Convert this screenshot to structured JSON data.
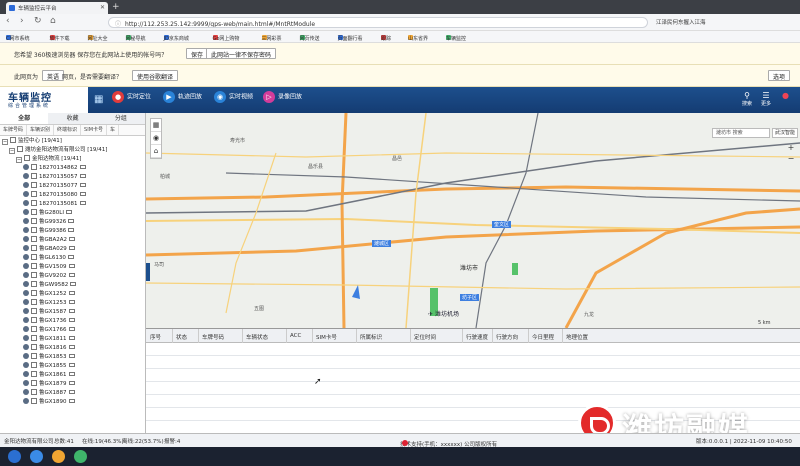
{
  "browser": {
    "tab_title": "车辆监控云平台",
    "url": "http://112.253.25.142:9999/gps-web/main.html#/MntRtModule",
    "address_right": "江泽民何东握入江海",
    "bookmarks": [
      "C网市系统",
      "软件下载",
      "网址大全",
      "网秘导航",
      "JD京东商城",
      "Go网上购物",
      "三网彩票",
      "网页传送",
      "页面翻行看",
      "跟踪",
      "山东省界",
      "车辆监控"
    ]
  },
  "notices": {
    "save_password_text": "您希望 360极速浏览器 保存您在此网站上使用的帐号吗？",
    "save_button": "保存",
    "never_button": "此网站一律不保存密码",
    "translate_prefix": "此网页为",
    "translate_lang_button": "英语",
    "translate_text": "网页，是否需要翻译？",
    "translate_button": "使用谷歌翻译",
    "options_button": "选项"
  },
  "app": {
    "title": "车辆监控",
    "subtitle": "综合管理系统",
    "nav": [
      {
        "label": "实时定位",
        "color": "#e23c3c"
      },
      {
        "label": "轨迹回放",
        "color": "#2a83d8"
      },
      {
        "label": "实时视频",
        "color": "#2a83d8"
      },
      {
        "label": "录像回放",
        "color": "#d23c9a"
      }
    ],
    "header_right": [
      "搜索",
      "更多"
    ]
  },
  "sidebar": {
    "tabs": [
      "全部",
      "收藏",
      "分组"
    ],
    "search_tabs": [
      "车牌号码",
      "车辆识别",
      "终端标识",
      "SIM卡号",
      "车"
    ],
    "tree": [
      {
        "label": "监控中心 [19/41]",
        "level": 0,
        "type": "group"
      },
      {
        "label": "潍坊金阳达物流有限公司 [19/41]",
        "level": 1,
        "type": "group"
      },
      {
        "label": "金阳达物流 [19/41]",
        "level": 2,
        "type": "group"
      },
      {
        "label": "18270134862",
        "level": 3,
        "type": "vehicle"
      },
      {
        "label": "18270135057",
        "level": 3,
        "type": "vehicle"
      },
      {
        "label": "18270135077",
        "level": 3,
        "type": "vehicle"
      },
      {
        "label": "18270135080",
        "level": 3,
        "type": "vehicle"
      },
      {
        "label": "18270135081",
        "level": 3,
        "type": "vehicle"
      },
      {
        "label": "鲁G280LI",
        "level": 3,
        "type": "vehicle"
      },
      {
        "label": "鲁G99326",
        "level": 3,
        "type": "vehicle"
      },
      {
        "label": "鲁G99386",
        "level": 3,
        "type": "vehicle"
      },
      {
        "label": "鲁GBA2A2",
        "level": 3,
        "type": "vehicle"
      },
      {
        "label": "鲁GBA029",
        "level": 3,
        "type": "vehicle"
      },
      {
        "label": "鲁GL6130",
        "level": 3,
        "type": "vehicle"
      },
      {
        "label": "鲁GV1509",
        "level": 3,
        "type": "vehicle"
      },
      {
        "label": "鲁GV9202",
        "level": 3,
        "type": "vehicle"
      },
      {
        "label": "鲁GW9582",
        "level": 3,
        "type": "vehicle"
      },
      {
        "label": "鲁GX1252",
        "level": 3,
        "type": "vehicle"
      },
      {
        "label": "鲁GX1253",
        "level": 3,
        "type": "vehicle"
      },
      {
        "label": "鲁GX1587",
        "level": 3,
        "type": "vehicle"
      },
      {
        "label": "鲁GX1736",
        "level": 3,
        "type": "vehicle"
      },
      {
        "label": "鲁GX1766",
        "level": 3,
        "type": "vehicle"
      },
      {
        "label": "鲁GX1811",
        "level": 3,
        "type": "vehicle"
      },
      {
        "label": "鲁GX1816",
        "level": 3,
        "type": "vehicle"
      },
      {
        "label": "鲁GX1853",
        "level": 3,
        "type": "vehicle"
      },
      {
        "label": "鲁GX1855",
        "level": 3,
        "type": "vehicle"
      },
      {
        "label": "鲁GX1861",
        "level": 3,
        "type": "vehicle"
      },
      {
        "label": "鲁GX1879",
        "level": 3,
        "type": "vehicle"
      },
      {
        "label": "鲁GX1887",
        "level": 3,
        "type": "vehicle"
      },
      {
        "label": "鲁GX1890",
        "level": 3,
        "type": "vehicle"
      }
    ]
  },
  "map": {
    "search_placeholder": "潍坊市 搜索",
    "layer_label": "武汉智能",
    "city_label": "潍坊市",
    "airport_label": "潍坊机场",
    "place_labels": [
      "寿光市",
      "昌乐县",
      "柏城",
      "昌邑",
      "九龙",
      "马司",
      "五图",
      "潍城区",
      "奎文区",
      "坊子区"
    ],
    "scale_label": "5 km"
  },
  "grid": {
    "columns": [
      "序号",
      "状态",
      "车牌号码",
      "车辆状态",
      "ACC",
      "SIM卡号",
      "所属标识",
      "定位时间",
      "行驶速度",
      "行驶方向",
      "今日里程",
      "地理位置"
    ]
  },
  "status_bar": {
    "company": "金阳达物流有限公司",
    "total": "总数:41",
    "online": "在线:19(46.3%)",
    "offline": "离线:22(53.7%)",
    "alarm": "报警:4",
    "support": "技术支持(手机：xxxxxx) 公司版权所有",
    "version_time": "版本:0.0.0.1 | 2022-11-09 10:40:50"
  },
  "watermark": {
    "text": "潍坊融媒"
  }
}
